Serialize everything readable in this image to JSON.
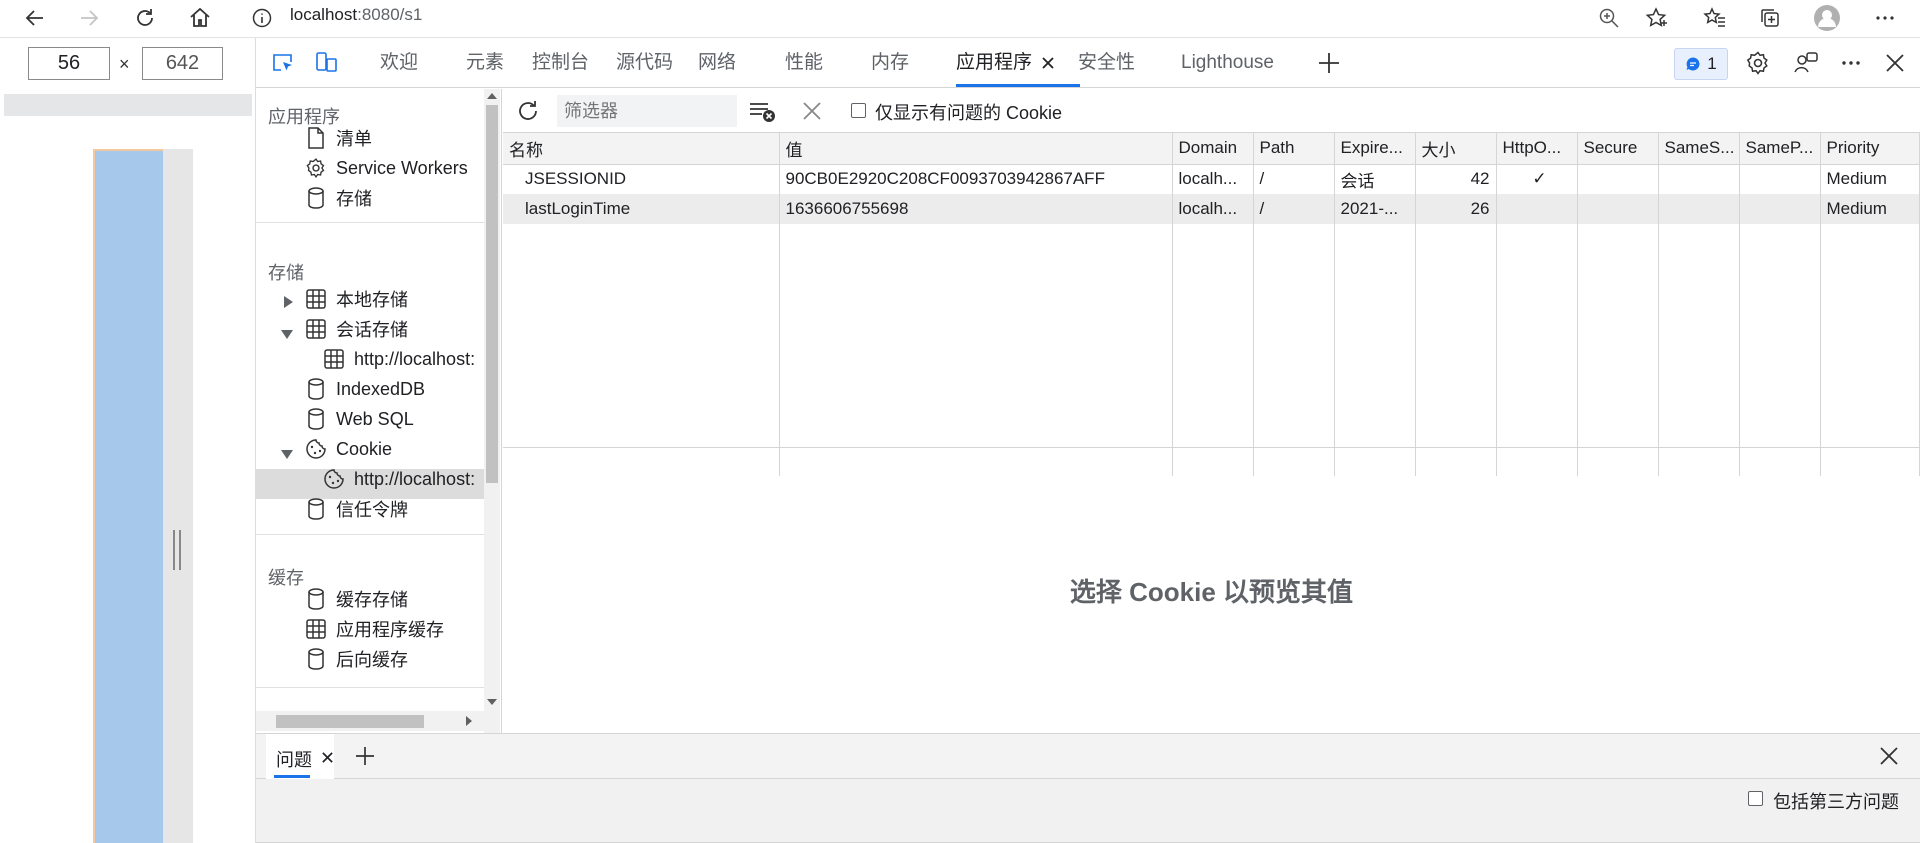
{
  "browser": {
    "url_host": "localhost",
    "url_rest": ":8080/s1"
  },
  "device": {
    "width": "56",
    "height": "642",
    "times": "×"
  },
  "tabs": [
    {
      "label": "欢迎"
    },
    {
      "label": "元素"
    },
    {
      "label": "控制台"
    },
    {
      "label": "源代码"
    },
    {
      "label": "网络"
    },
    {
      "label": "性能"
    },
    {
      "label": "内存"
    },
    {
      "label": "应用程序"
    },
    {
      "label": "安全性"
    },
    {
      "label": "Lighthouse"
    }
  ],
  "active_tab": "应用程序",
  "issues_count": "1",
  "sidebar": {
    "app_header": "应用程序",
    "manifest": "清单",
    "service_workers": "Service Workers",
    "storage_item": "存储",
    "storage_header": "存储",
    "local_storage": "本地存储",
    "session_storage": "会话存储",
    "session_origin": "http://localhost:",
    "indexeddb": "IndexedDB",
    "websql": "Web SQL",
    "cookie": "Cookie",
    "cookie_origin": "http://localhost:",
    "trust_tokens": "信任令牌",
    "cache_header": "缓存",
    "cache_storage": "缓存存储",
    "app_cache": "应用程序缓存",
    "bfcache": "后向缓存"
  },
  "toolbar": {
    "filter_placeholder": "筛选器",
    "only_issues_label": "仅显示有问题的 Cookie"
  },
  "cookie_table": {
    "columns": [
      "名称",
      "值",
      "Domain",
      "Path",
      "Expire...",
      "大小",
      "HttpO...",
      "Secure",
      "SameS...",
      "SameP...",
      "Priority"
    ],
    "rows": [
      {
        "name": "JSESSIONID",
        "value": "90CB0E2920C208CF0093703942867AFF",
        "domain": "localh...",
        "path": "/",
        "expires": "会话",
        "size": "42",
        "httponly": "✓",
        "secure": "",
        "samesite": "",
        "sameparty": "",
        "priority": "Medium"
      },
      {
        "name": "lastLoginTime",
        "value": "1636606755698",
        "domain": "localh...",
        "path": "/",
        "expires": "2021-...",
        "size": "26",
        "httponly": "",
        "secure": "",
        "samesite": "",
        "sameparty": "",
        "priority": "Medium"
      }
    ]
  },
  "preview_message": "选择 Cookie 以预览其值",
  "drawer": {
    "tab_label": "问题",
    "third_party_label": "包括第三方问题"
  },
  "colors": {
    "accent": "#1a73e8",
    "device": "#a5c8eb"
  }
}
